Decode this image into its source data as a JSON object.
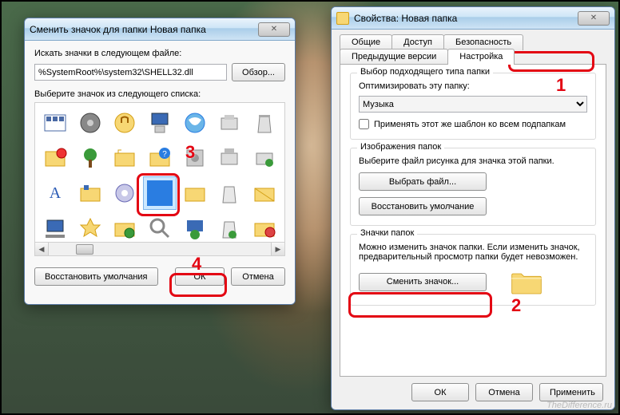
{
  "watermark": "TheDifference.ru",
  "annotations": {
    "n1": "1",
    "n2": "2",
    "n3": "3",
    "n4": "4"
  },
  "changeIcon": {
    "title": "Сменить значок для папки Новая папка",
    "searchLabel": "Искать значки в следующем файле:",
    "pathValue": "%SystemRoot%\\system32\\SHELL32.dll",
    "browse": "Обзор...",
    "selectLabel": "Выберите значок из следующего списка:",
    "restoreDefaults": "Восстановить умолчания",
    "ok": "ОК",
    "cancel": "Отмена"
  },
  "properties": {
    "title": "Свойства: Новая папка",
    "tabs": {
      "general": "Общие",
      "sharing": "Доступ",
      "security": "Безопасность",
      "previous": "Предыдущие версии",
      "customize": "Настройка"
    },
    "typeGroup": {
      "legend": "Выбор подходящего типа папки",
      "optimize": "Оптимизировать эту папку:",
      "selected": "Музыка",
      "applySub": "Применять этот же шаблон ко всем подпапкам"
    },
    "imagesGroup": {
      "legend": "Изображения папок",
      "hint": "Выберите файл рисунка для значка этой папки.",
      "chooseFile": "Выбрать файл...",
      "restore": "Восстановить умолчание"
    },
    "iconsGroup": {
      "legend": "Значки папок",
      "hint1": "Можно изменить значок папки. Если изменить значок,",
      "hint2": "предварительный просмотр папки будет невозможен.",
      "changeIcon": "Сменить значок..."
    },
    "buttons": {
      "ok": "ОК",
      "cancel": "Отмена",
      "apply": "Применить"
    }
  }
}
